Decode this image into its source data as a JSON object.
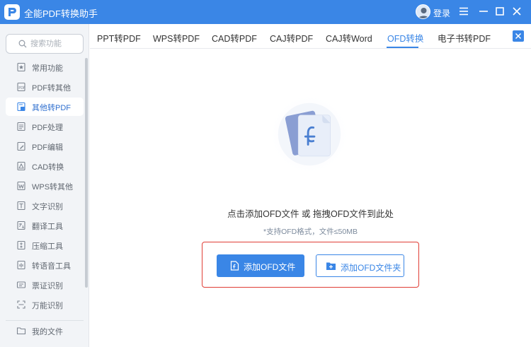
{
  "app": {
    "title": "全能PDF转换助手",
    "login_label": "登录"
  },
  "colors": {
    "accent": "#3a86e6",
    "highlight_border": "#e03e36",
    "sidebar_bg": "#f2f4f7"
  },
  "sidebar": {
    "search_placeholder": "搜索功能",
    "items": [
      {
        "label": "常用功能",
        "icon": "star-doc-icon"
      },
      {
        "label": "PDF转其他",
        "icon": "pdf-convert-icon"
      },
      {
        "label": "其他转PDF",
        "icon": "to-pdf-icon",
        "active": true
      },
      {
        "label": "PDF处理",
        "icon": "pdf-process-icon"
      },
      {
        "label": "PDF编辑",
        "icon": "pdf-edit-icon"
      },
      {
        "label": "CAD转换",
        "icon": "cad-icon"
      },
      {
        "label": "WPS转其他",
        "icon": "wps-icon"
      },
      {
        "label": "文字识别",
        "icon": "ocr-icon"
      },
      {
        "label": "翻译工具",
        "icon": "translate-icon"
      },
      {
        "label": "压缩工具",
        "icon": "compress-icon"
      },
      {
        "label": "转语音工具",
        "icon": "voice-icon"
      },
      {
        "label": "票证识别",
        "icon": "ticket-icon"
      },
      {
        "label": "万能识别",
        "icon": "scan-icon"
      }
    ],
    "my_files_label": "我的文件"
  },
  "tabs": [
    {
      "label": "PPT转PDF"
    },
    {
      "label": "WPS转PDF"
    },
    {
      "label": "CAD转PDF"
    },
    {
      "label": "CAJ转PDF"
    },
    {
      "label": "CAJ转Word"
    },
    {
      "label": "OFD转换",
      "active": true
    },
    {
      "label": "电子书转PDF"
    }
  ],
  "main": {
    "drop_text": "点击添加OFD文件 或 拖拽OFD文件到此处",
    "hint_text": "*支持OFD格式，文件≤50MB",
    "add_file_label": "添加OFD文件",
    "add_folder_label": "添加OFD文件夹"
  }
}
